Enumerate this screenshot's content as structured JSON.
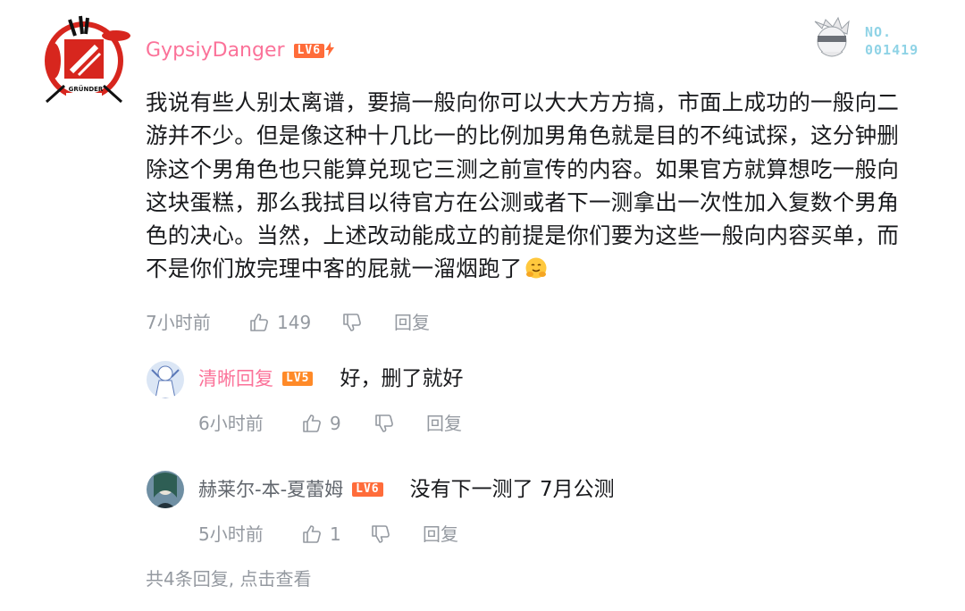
{
  "comment": {
    "username": "GypsiyDanger",
    "level": "LV6",
    "fan_badge": {
      "label": "NO.",
      "number": "001419"
    },
    "text": "我说有些人别太离谱，要搞一般向你可以大大方方搞，市面上成功的一般向二\n游并不少。但是像这种十几比一的比例加男角色就是目的不纯试探，这分钟删\n除这个男角色也只能算兑现它三测之前宣传的内容。如果官方就算想吃一般向\n这块蛋糕，那么我拭目以待官方在公测或者下一测拿出一次性加入复数个男角\n色的决心。当然，上述改动能成立的前提是你们要为这些一般向内容买单，而\n不是你们放完理中客的屁就一溜烟跑了",
    "avatar_caption": "GRÜNDER",
    "time": "7小时前",
    "likes": "149",
    "reply_label": "回复"
  },
  "replies": [
    {
      "username": "清晰回复",
      "level": "LV5",
      "text": "好，删了就好",
      "time": "6小时前",
      "likes": "9",
      "reply_label": "回复"
    },
    {
      "username": "赫莱尔-本-夏蕾姆",
      "level": "LV6",
      "text": "没有下一测了  7月公测",
      "time": "5小时前",
      "likes": "1",
      "reply_label": "回复"
    }
  ],
  "footer": {
    "summary": "共4条回复, 点击查看"
  },
  "colors": {
    "username": "#fb7299",
    "meta": "#9499a0",
    "level": "#ff6c3a",
    "text": "#18191c"
  }
}
